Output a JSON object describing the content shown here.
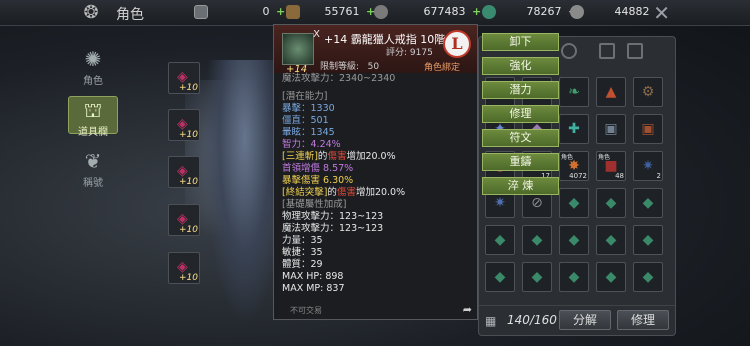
{
  "header": {
    "title": "角色",
    "currencies": [
      {
        "icon": "card-icon",
        "value": "0",
        "color": "#b0b0b0"
      },
      {
        "icon": "scroll-icon",
        "value": "55761",
        "color": "#c8a060"
      },
      {
        "icon": "coin-icon",
        "value": "677483",
        "color": "#c0c0c0"
      },
      {
        "icon": "gem-icon",
        "value": "78267",
        "color": "#60b090"
      },
      {
        "icon": "silver-icon",
        "value": "44882",
        "color": "#a8a8a8"
      }
    ]
  },
  "nav": [
    {
      "label": "角色",
      "icon": "emblem-icon",
      "active": false
    },
    {
      "label": "道具欄",
      "icon": "bag-icon",
      "active": true
    },
    {
      "label": "稱號",
      "icon": "wing-icon",
      "active": false
    }
  ],
  "equip_slots": [
    {
      "level": "+10"
    },
    {
      "level": "+10"
    },
    {
      "level": "+10"
    },
    {
      "level": "+10"
    },
    {
      "level": "+10"
    }
  ],
  "tooltip": {
    "item_level": "+14",
    "name": "+14 霸龍獵人戒指 10階",
    "score_label": "評分:",
    "score": "9175",
    "req_label": "限制等級:",
    "req_level": "50",
    "grade": "L",
    "bound": "角色綁定",
    "lines": [
      {
        "text": "魔法攻擊力：2340~2340",
        "color": "gray"
      },
      {
        "text": "",
        "color": "gray"
      },
      {
        "text": "[潛在能力]",
        "color": "gray"
      },
      {
        "text": "暴擊：1330",
        "color": "blue"
      },
      {
        "text": "僵直：501",
        "color": "blue"
      },
      {
        "text": "暈眩：1345",
        "color": "blue"
      },
      {
        "text": "智力：4.24%",
        "color": "purple"
      },
      {
        "parts": [
          [
            "[三連斬]",
            "yellow"
          ],
          [
            "的",
            "white"
          ],
          [
            "傷害",
            "red"
          ],
          [
            "增加20.0%",
            "white"
          ]
        ]
      },
      {
        "text": "首領增傷 8.57%",
        "color": "purple"
      },
      {
        "text": "暴擊傷害 6.30%",
        "color": "yellow"
      },
      {
        "parts": [
          [
            "[終結突擊]",
            "yellow"
          ],
          [
            "的",
            "white"
          ],
          [
            "傷害",
            "red"
          ],
          [
            "增加20.0%",
            "white"
          ]
        ]
      },
      {
        "text": "[基礎屬性加成]",
        "color": "gray"
      },
      {
        "text": "物理攻擊力：123~123",
        "color": "white"
      },
      {
        "text": "魔法攻擊力：123~123",
        "color": "white"
      },
      {
        "text": "力量：35",
        "color": "white"
      },
      {
        "text": "敏捷：35",
        "color": "white"
      },
      {
        "text": "體質：29",
        "color": "white"
      },
      {
        "text": "MAX HP:    898",
        "color": "white"
      },
      {
        "text": "MAX MP:    837",
        "color": "white"
      }
    ],
    "footer": "不可交易"
  },
  "actions": [
    "卸下",
    "強化",
    "潛力",
    "修理",
    "符文",
    "重鑄",
    "淬 煉"
  ],
  "inventory": {
    "count": "140/160",
    "decompose": "分解",
    "repair": "修理",
    "items": [
      {
        "g": "✦",
        "c": "#c0302a",
        "cnt": "",
        "tag": ""
      },
      {
        "g": "✧",
        "c": "#d04050",
        "cnt": "",
        "tag": ""
      },
      {
        "g": "❧",
        "c": "#40a070",
        "cnt": "",
        "tag": ""
      },
      {
        "g": "▲",
        "c": "#c05030",
        "cnt": "",
        "tag": ""
      },
      {
        "g": "⚙",
        "c": "#8a6a4a",
        "cnt": "",
        "tag": ""
      },
      {
        "g": "✦",
        "c": "#6a8ad0",
        "cnt": "",
        "tag": ""
      },
      {
        "g": "◆",
        "c": "#9a7ab0",
        "cnt": "",
        "tag": ""
      },
      {
        "g": "✚",
        "c": "#40b0a0",
        "cnt": "",
        "tag": ""
      },
      {
        "g": "▣",
        "c": "#708090",
        "cnt": "",
        "tag": ""
      },
      {
        "g": "▣",
        "c": "#a05030",
        "cnt": "",
        "tag": ""
      },
      {
        "g": "◎",
        "c": "#b04040",
        "cnt": "",
        "tag": ""
      },
      {
        "g": "✸",
        "c": "#d06030",
        "cnt": "17",
        "tag": ""
      },
      {
        "g": "✸",
        "c": "#d07030",
        "cnt": "4072",
        "tag": "角色"
      },
      {
        "g": "■",
        "c": "#a03030",
        "cnt": "48",
        "tag": "角色"
      },
      {
        "g": "✷",
        "c": "#4060a0",
        "cnt": "2",
        "tag": ""
      },
      {
        "g": "✷",
        "c": "#5070b0",
        "cnt": "",
        "tag": ""
      },
      {
        "g": "⊘",
        "c": "#8a8a8a",
        "cnt": "",
        "tag": ""
      },
      {
        "g": "◆",
        "c": "#3a8a6a",
        "cnt": "",
        "tag": ""
      },
      {
        "g": "◆",
        "c": "#3a8a6a",
        "cnt": "",
        "tag": ""
      },
      {
        "g": "◆",
        "c": "#3a8a6a",
        "cnt": "",
        "tag": ""
      },
      {
        "g": "◆",
        "c": "#3a8a6a",
        "cnt": "",
        "tag": ""
      },
      {
        "g": "◆",
        "c": "#3a8a6a",
        "cnt": "",
        "tag": ""
      },
      {
        "g": "◆",
        "c": "#3a8a6a",
        "cnt": "",
        "tag": ""
      },
      {
        "g": "◆",
        "c": "#3a8a6a",
        "cnt": "",
        "tag": ""
      },
      {
        "g": "◆",
        "c": "#3a8a6a",
        "cnt": "",
        "tag": ""
      },
      {
        "g": "◆",
        "c": "#3a8a6a",
        "cnt": "",
        "tag": ""
      },
      {
        "g": "◆",
        "c": "#3a8a6a",
        "cnt": "",
        "tag": ""
      },
      {
        "g": "◆",
        "c": "#3a8a6a",
        "cnt": "",
        "tag": ""
      },
      {
        "g": "◆",
        "c": "#3a8a6a",
        "cnt": "",
        "tag": ""
      },
      {
        "g": "◆",
        "c": "#3a8a6a",
        "cnt": "",
        "tag": ""
      },
      {
        "g": "◆",
        "c": "#3a8a6a",
        "cnt": "",
        "tag": ""
      },
      {
        "g": "◆",
        "c": "#3a8a6a",
        "cnt": "",
        "tag": ""
      },
      {
        "g": "◆",
        "c": "#3a8a6a",
        "cnt": "",
        "tag": ""
      }
    ]
  }
}
